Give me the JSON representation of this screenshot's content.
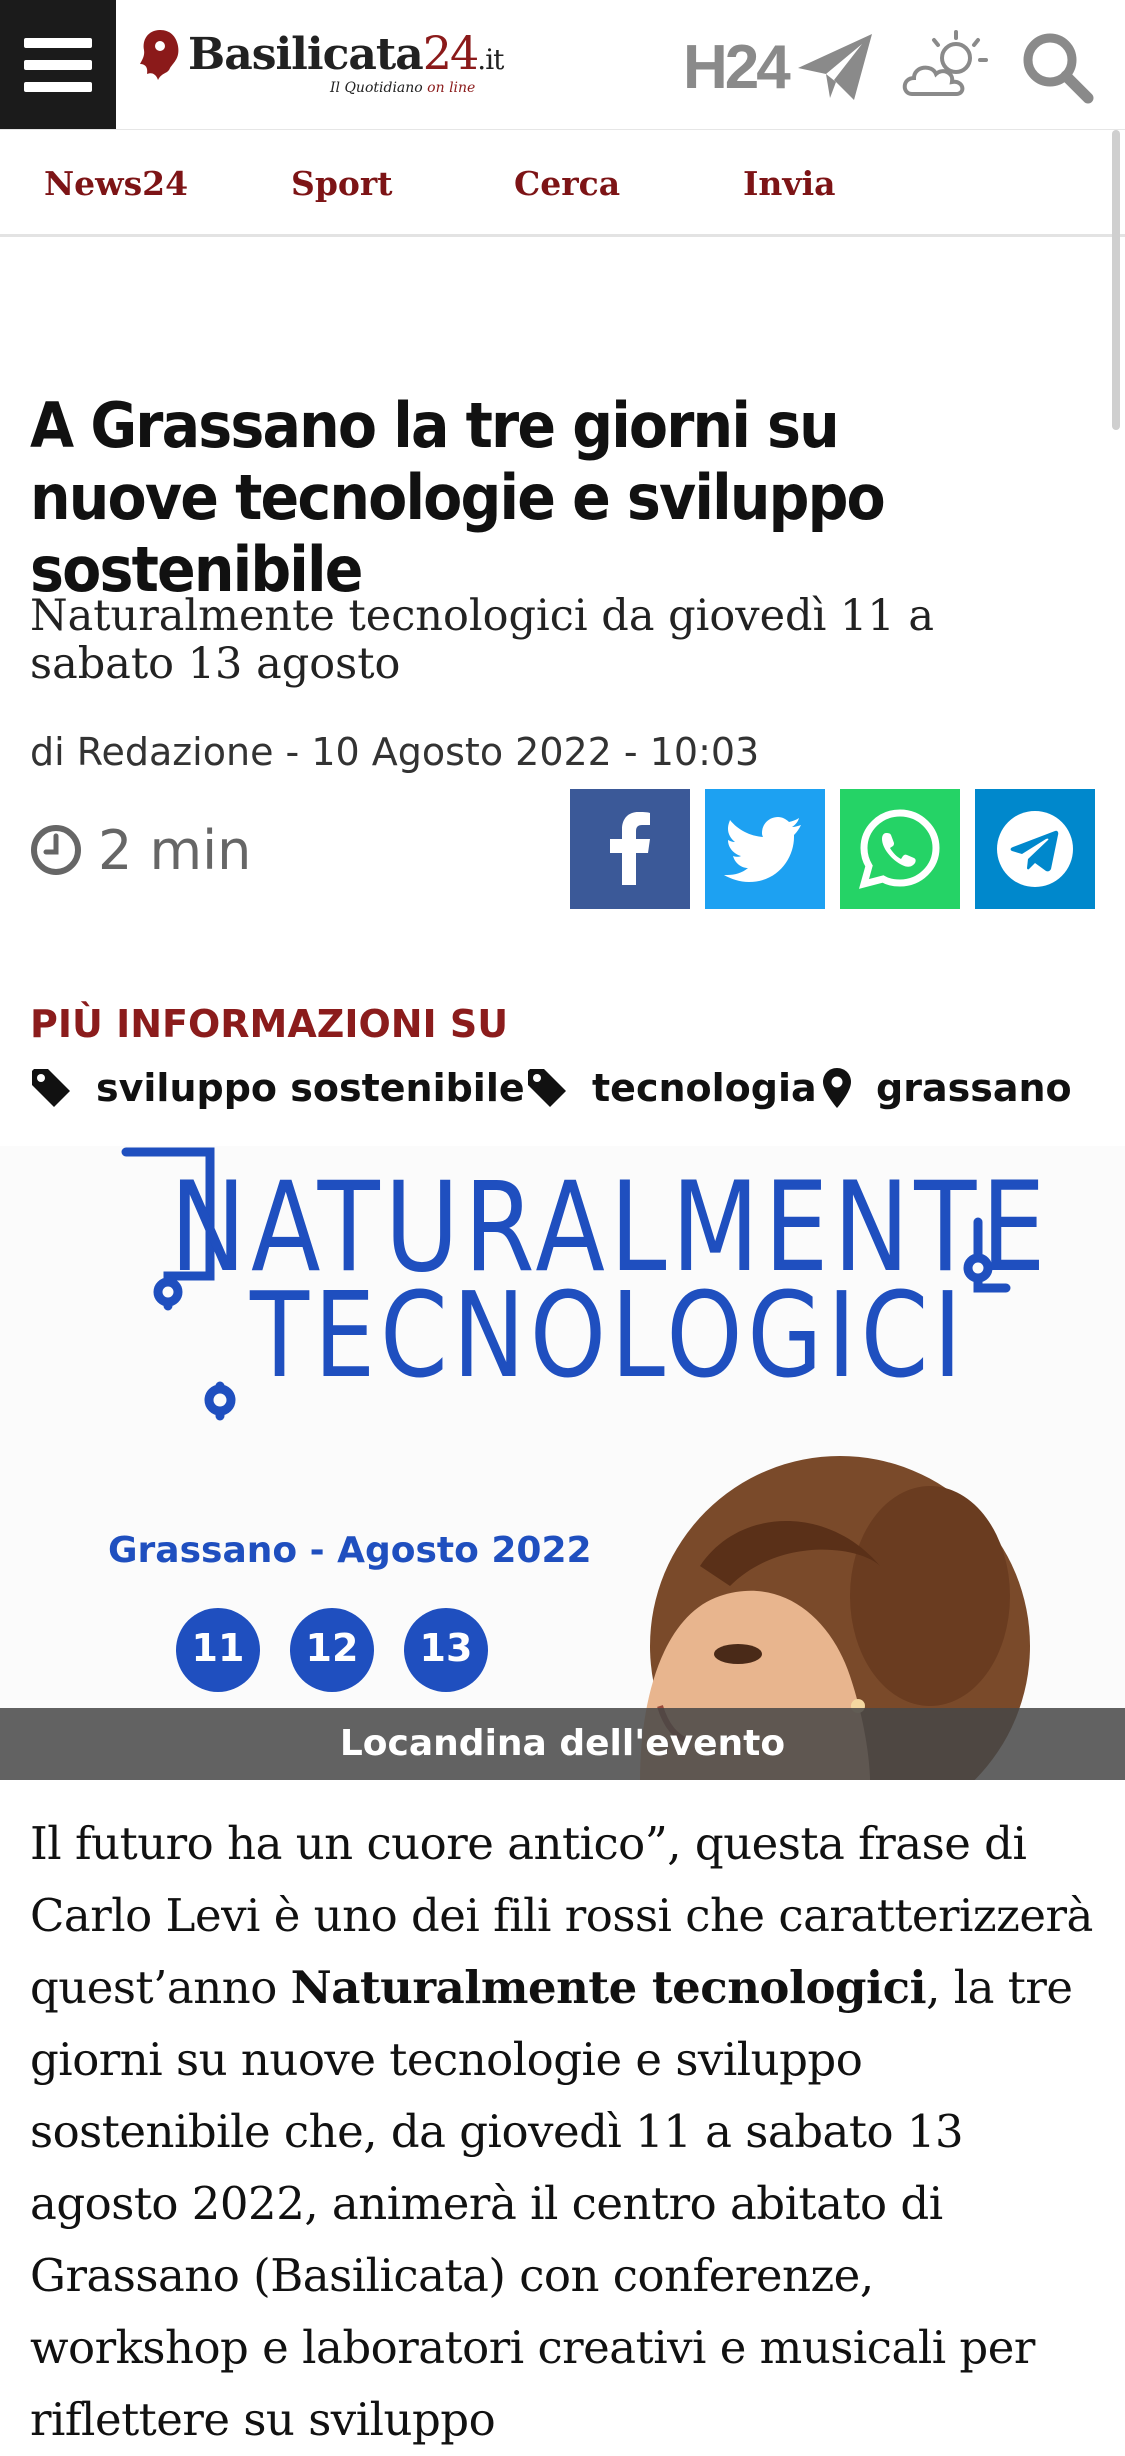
{
  "header": {
    "logo_name": "Basilicata",
    "logo_number": "24",
    "logo_domain": ".it",
    "logo_tagline_prefix": "Il Quotidiano",
    "logo_tagline_suffix": "on line",
    "h24_label": "H24",
    "icons": [
      "menu-icon",
      "paper-plane-icon",
      "weather-sun-cloud-icon",
      "search-icon"
    ]
  },
  "nav": {
    "items": [
      "News24",
      "Sport",
      "Cerca",
      "Invia"
    ]
  },
  "article": {
    "headline": "A Grassano la tre giorni su nuove tecnologie e sviluppo sostenibile",
    "subtitle": "Naturalmente tecnologici da giovedì 11 a sabato 13 agosto",
    "byline": "di Redazione - 10 Agosto 2022 - 10:03",
    "read_time": "2 min",
    "share_buttons": [
      "facebook",
      "twitter",
      "whatsapp",
      "telegram"
    ],
    "more_info_label": "PIÙ INFORMAZIONI SU",
    "tags": [
      {
        "icon": "tag-icon",
        "label": "sviluppo sostenibile"
      },
      {
        "icon": "tag-icon",
        "label": "tecnologia"
      },
      {
        "icon": "location-pin-icon",
        "label": "grassano"
      }
    ],
    "image": {
      "title_line1": "NATURALMENTE",
      "title_line2": "TECNOLOGICI",
      "place_date": "Grassano - Agosto 2022",
      "days": [
        "11",
        "12",
        "13"
      ],
      "caption": "Locandina dell'evento"
    },
    "body": {
      "p1_start": "Il futuro ha un cuore antico”, questa frase di Carlo Levi è uno dei fili rossi che caratterizzerà quest’anno ",
      "p1_bold": "Naturalmente tecnologici",
      "p1_end": ", la tre giorni su nuove tecnologie e sviluppo sostenibile che, da giovedì 11 a sabato 13 agosto 2022, animerà il centro abitato di Grassano (Basilicata) con conferenze, workshop e laboratori creativi e musicali per riflettere su sviluppo"
    }
  },
  "colors": {
    "brand_red": "#7d1416",
    "facebook": "#3b5998",
    "twitter": "#1da1f2",
    "whatsapp": "#25d366",
    "telegram": "#0088cc",
    "poster_blue": "#1f4fbf"
  }
}
